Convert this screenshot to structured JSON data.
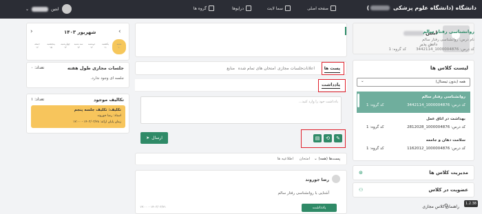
{
  "topbar": {
    "brand": "دانشگاه",
    "brand_suffix": "(دانشگاه علوم پزشکی",
    "brand_close": ")",
    "nav": [
      "صفحه اصلی",
      "سما لایت",
      "درایوها",
      "گروه ها"
    ],
    "user_name": "ابتین"
  },
  "profile": {
    "name": "ابتین",
    "role": "دانش پذیر"
  },
  "class_list": {
    "title": "لیست کلاس ها",
    "filter": "همه (بدون تیسنال)",
    "items": [
      {
        "title": "روانشناسی رفتار سالم",
        "code": "کد درس: 1000004876_3442114",
        "group": "کد گروه: 1"
      },
      {
        "title": "بهداشت در اتاق عمل",
        "code": "کد درس: 1000004876_2812028",
        "group": "کد گروه: 1"
      },
      {
        "title": "سلامت دهان و جامعه",
        "code": "کد درس: 1000004876_1162012",
        "group": "کد گروه: 1"
      }
    ]
  },
  "side_rows": {
    "manage": "مدیریت کلاس ها",
    "join": "عضویت در کلاس",
    "guide": "راهنمای کلاس مجازی"
  },
  "course": {
    "title": "روانشناسی رفتار سالم",
    "subtitle": "نام درس: روانشناسی رفتار سالم",
    "code": "کد درس: 1000004876_3442114",
    "group": "کد گروه: 1"
  },
  "tabs": [
    "پست ها",
    "اعلانات",
    "جلسات مجازی",
    "امتحان های تمام شده",
    "منابع"
  ],
  "note_tab": "یادداشت",
  "textarea_placeholder": "یادداشت خود را وارد کنید...",
  "send_label": "ارسال",
  "posts_tabs": [
    "پست‌ها (همه)",
    "امتحان",
    "اطلاعیه ها"
  ],
  "post": {
    "author": "رضا جوروند",
    "body": "آشنایی با روانشناسی رفتار سالم",
    "time": "۱۴۰۳/۰۳/۲۱ - ۱۴:۰۰",
    "note_button": "یادداشت"
  },
  "calendar": {
    "title": "شهریور ۱۴۰۳",
    "days": [
      "شنبه",
      "یکشنبه",
      "دوشنبه",
      "سه شنبه",
      "چهارشنبه",
      "پنجشنبه",
      "جمعه"
    ],
    "dates": [
      "۱۰",
      "۱۱",
      "۱۲",
      "۱۳",
      "۱۴",
      "۱۵",
      "۱۶"
    ]
  },
  "weekly": {
    "title": "جلسات مجازی طول هفته",
    "count_label": "تعداد: ۰",
    "empty": "جلسه ای وجود ندارد."
  },
  "tasks": {
    "title": "تکالیف موجود",
    "count_label": "تعداد: ۱",
    "task_title": "تکلیف: تکلیف جلسه پنجم",
    "task_teacher": "استاد: رضا جوروند",
    "task_deadline": "زمان پایان ارائه: ۱۴۰۳/۰۳/۲۸ - ۱۲:۰۰"
  },
  "version": "1.2.38",
  "colors": {
    "topbar": "#2b2d35",
    "accent": "#2f8a67",
    "active_item": "#6fae9d",
    "highlight": "#e01f2a",
    "today": "#f6c75b"
  }
}
